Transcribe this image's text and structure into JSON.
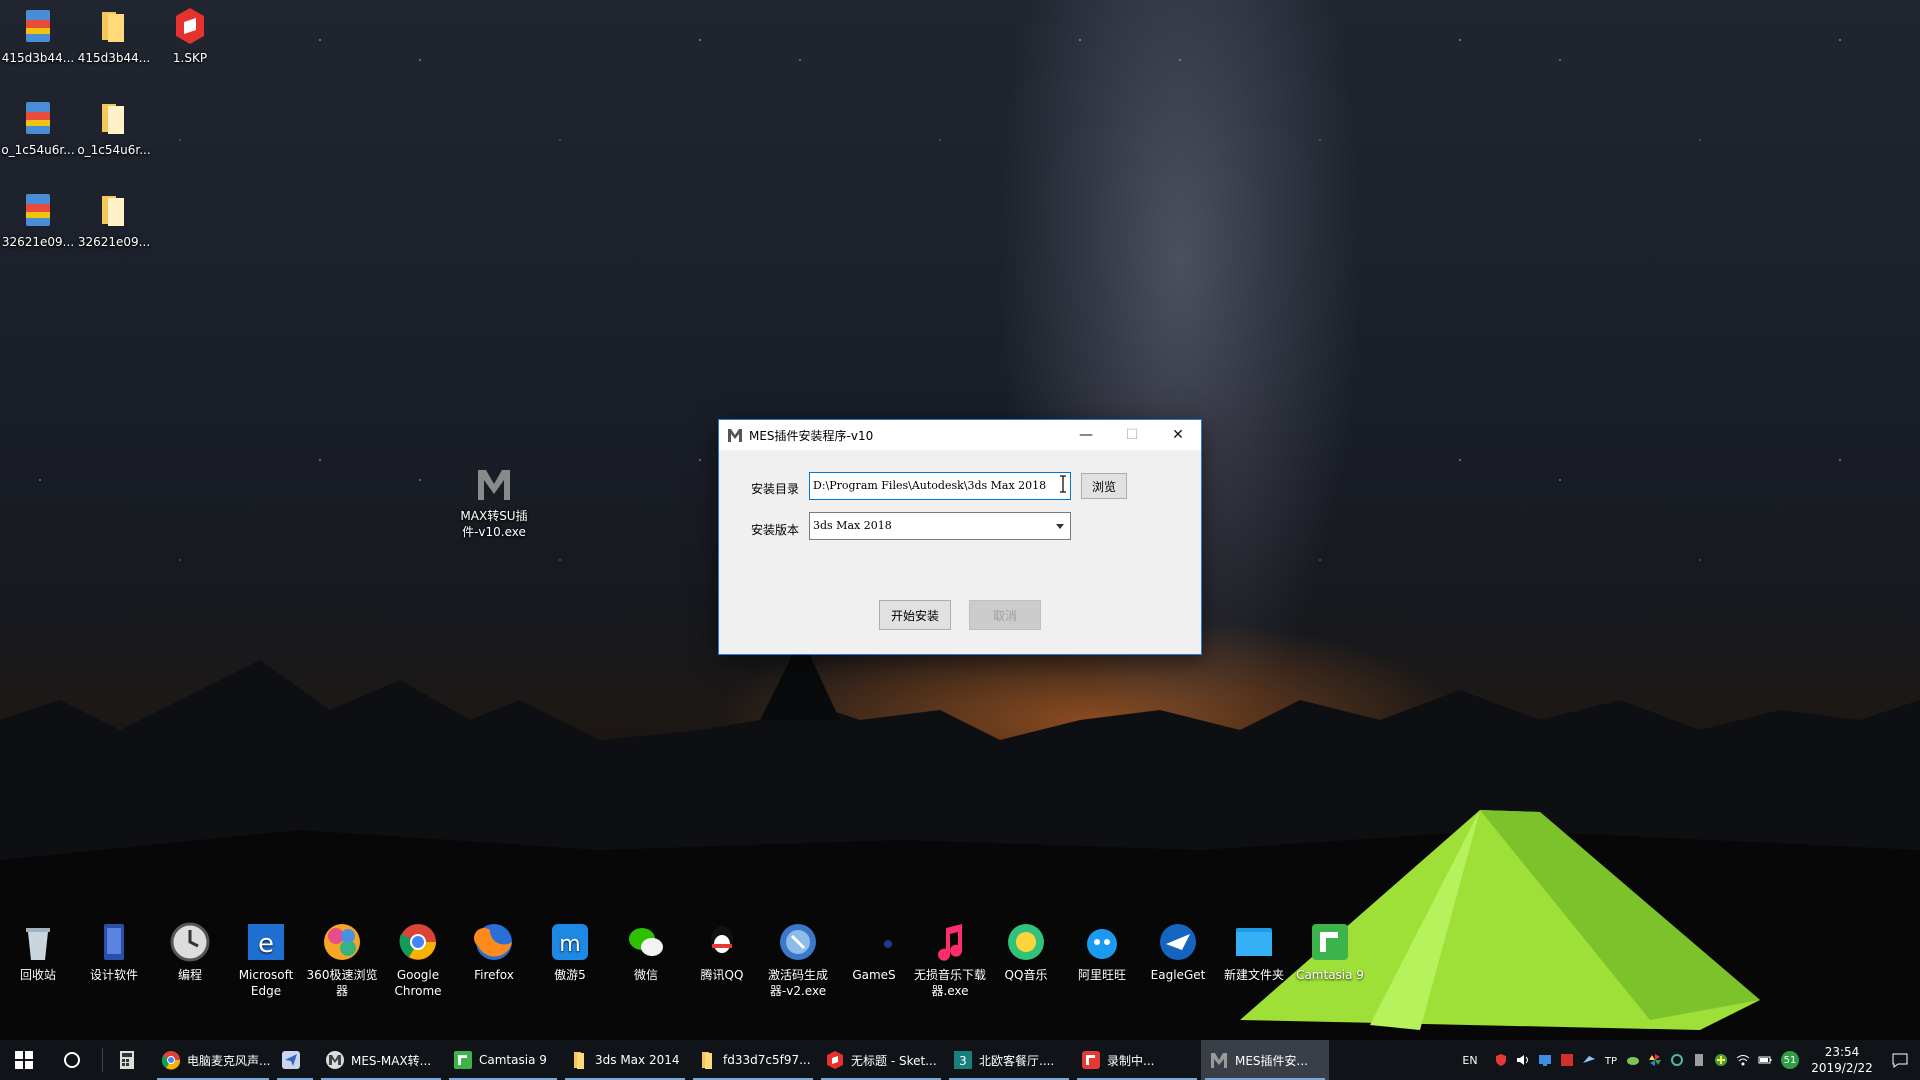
{
  "desktop_icons": [
    {
      "label": "415d3b44...",
      "icon": "winrar-archive-icon"
    },
    {
      "label": "415d3b44...",
      "icon": "folder-icon"
    },
    {
      "label": "1.SKP",
      "icon": "sketchup-file-icon"
    },
    {
      "label": "o_1c54u6r...",
      "icon": "winrar-archive-icon"
    },
    {
      "label": "o_1c54u6r...",
      "icon": "folder-icon"
    },
    {
      "label": "32621e09...",
      "icon": "winrar-archive-icon"
    },
    {
      "label": "32621e09...",
      "icon": "folder-icon"
    },
    {
      "label": "MAX转SU插件-v10.exe",
      "icon": "mes-m-icon"
    }
  ],
  "dock": [
    {
      "label": "回收站",
      "icon": "recycle-bin-icon"
    },
    {
      "label": "设计软件",
      "icon": "design-software-icon"
    },
    {
      "label": "编程",
      "icon": "clock-icon"
    },
    {
      "label": "Microsoft Edge",
      "icon": "edge-icon"
    },
    {
      "label": "360极速浏览器",
      "icon": "360-browser-icon"
    },
    {
      "label": "Google Chrome",
      "icon": "chrome-icon"
    },
    {
      "label": "Firefox",
      "icon": "firefox-icon"
    },
    {
      "label": "傲游5",
      "icon": "maxthon-icon"
    },
    {
      "label": "微信",
      "icon": "wechat-icon"
    },
    {
      "label": "腾讯QQ",
      "icon": "qq-icon"
    },
    {
      "label": "激活码生成器-v2.exe",
      "icon": "keygen-icon"
    },
    {
      "label": "GameS",
      "icon": "games-icon"
    },
    {
      "label": "无损音乐下载器.exe",
      "icon": "music-note-icon"
    },
    {
      "label": "QQ音乐",
      "icon": "qq-music-icon"
    },
    {
      "label": "阿里旺旺",
      "icon": "aliwangwang-icon"
    },
    {
      "label": "EagleGet",
      "icon": "eagleget-icon"
    },
    {
      "label": "新建文件夹",
      "icon": "new-folder-icon"
    },
    {
      "label": "Camtasia 9",
      "icon": "camtasia-icon"
    }
  ],
  "dialog": {
    "title": "MES插件安装程序-v10",
    "install_dir_label": "安装目录",
    "install_dir_value": "D:\\Program Files\\Autodesk\\3ds Max 2018",
    "browse_label": "浏览",
    "version_label": "安装版本",
    "version_value": "3ds Max 2018",
    "start_label": "开始安装",
    "cancel_label": "取消",
    "minimize_glyph": "—",
    "maximize_glyph": "☐",
    "close_glyph": "✕"
  },
  "taskbar": {
    "items": [
      {
        "label": "",
        "icon": "calculator-icon",
        "running": false
      },
      {
        "label": "电脑麦克风声...",
        "icon": "chrome-icon",
        "running": true
      },
      {
        "label": "",
        "icon": "paper-plane-icon",
        "running": true
      },
      {
        "label": "MES-MAX转...",
        "icon": "mes-m-icon",
        "running": true
      },
      {
        "label": "Camtasia 9",
        "icon": "camtasia-icon",
        "running": true
      },
      {
        "label": "3ds Max 2014",
        "icon": "folder-icon",
        "running": true
      },
      {
        "label": "fd33d7c5f97...",
        "icon": "folder-icon",
        "running": true
      },
      {
        "label": "无标题 - Sket...",
        "icon": "sketchup-icon",
        "running": true
      },
      {
        "label": "北欧客餐厅....",
        "icon": "3dsmax-icon",
        "running": true
      },
      {
        "label": "录制中...",
        "icon": "camtasia-recorder-icon",
        "running": true
      },
      {
        "label": "MES插件安...",
        "icon": "mes-m-icon",
        "running": true,
        "active": true
      }
    ],
    "tray": {
      "lang": "EN",
      "time": "23:54",
      "date": "2019/2/22",
      "badge": "51"
    }
  },
  "colors": {
    "dialog_border": "#2b78d8",
    "taskbar_bg": "#101318",
    "tent_green": "#9ee038"
  }
}
